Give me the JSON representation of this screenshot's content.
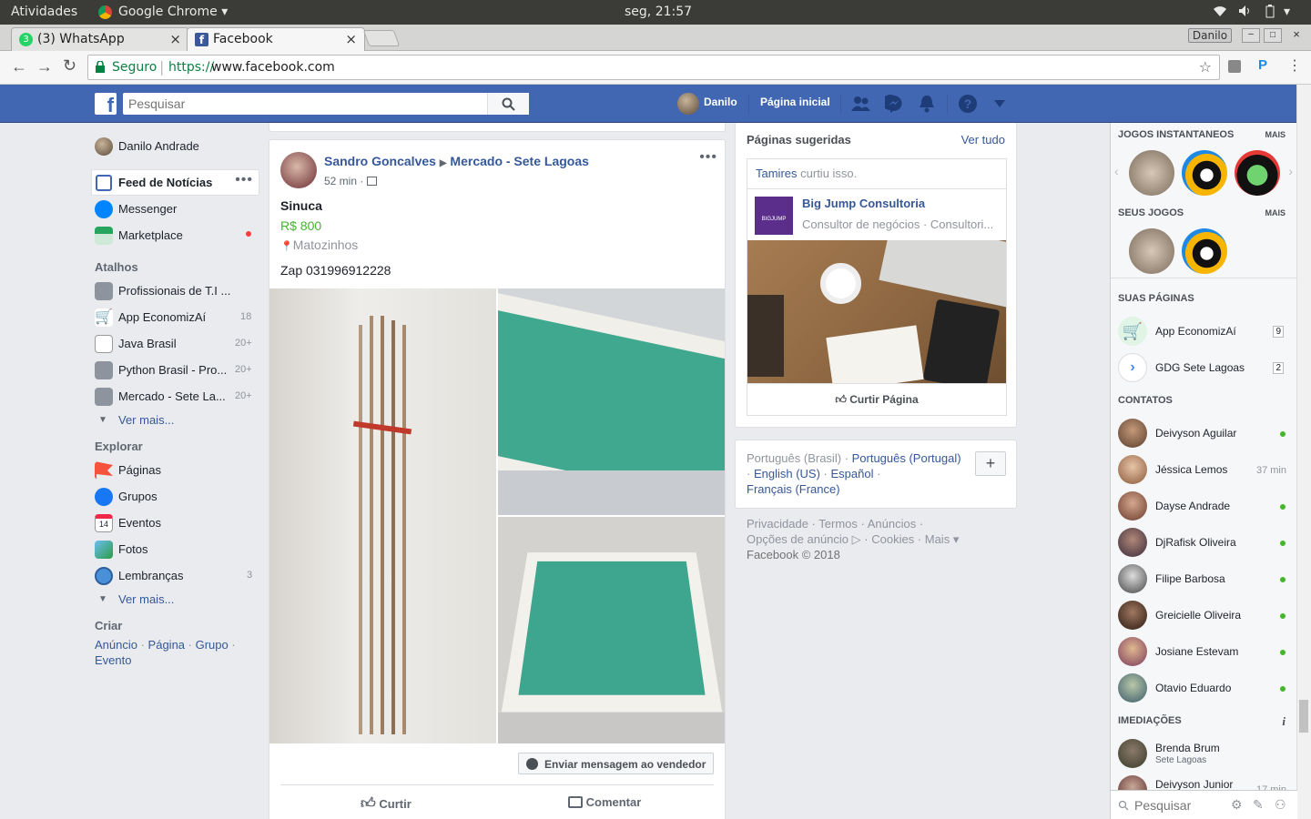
{
  "system_bar": {
    "activities": "Atividades",
    "app": "Google Chrome",
    "clock": "seg, 21:57"
  },
  "tabs": [
    {
      "label": "(3) WhatsApp",
      "close": "×"
    },
    {
      "label": "Facebook",
      "close": "×"
    }
  ],
  "window": {
    "user_label": "Danilo"
  },
  "address": {
    "secure_label": "Seguro",
    "url_prefix": "https://",
    "url_host": "www.facebook.com"
  },
  "fb_header": {
    "search_placeholder": "Pesquisar",
    "profile_name": "Danilo",
    "home": "Página inicial"
  },
  "left": {
    "profile": "Danilo Andrade",
    "main": [
      {
        "label": "Feed de Notícias"
      },
      {
        "label": "Messenger"
      },
      {
        "label": "Marketplace"
      }
    ],
    "shortcuts_title": "Atalhos",
    "shortcuts": [
      {
        "label": "Profissionais de T.I ...",
        "count": ""
      },
      {
        "label": "App EconomizAí",
        "count": "18"
      },
      {
        "label": "Java Brasil",
        "count": "20+"
      },
      {
        "label": "Python Brasil - Pro...",
        "count": "20+"
      },
      {
        "label": "Mercado - Sete La...",
        "count": "20+"
      }
    ],
    "see_more": "Ver mais...",
    "explore_title": "Explorar",
    "explore": [
      {
        "label": "Páginas",
        "count": ""
      },
      {
        "label": "Grupos",
        "count": ""
      },
      {
        "label": "Eventos",
        "count": ""
      },
      {
        "label": "Fotos",
        "count": ""
      },
      {
        "label": "Lembranças",
        "count": "3"
      }
    ],
    "see_more2": "Ver mais...",
    "create_title": "Criar",
    "create_links": [
      "Anúncio",
      "Página",
      "Grupo",
      "Evento"
    ]
  },
  "post": {
    "author": "Sandro Goncalves",
    "group": "Mercado - Sete Lagoas",
    "time": "52 min",
    "title": "Sinuca",
    "price": "R$ 800",
    "location": "Matozinhos",
    "body": "Zap 031996912228",
    "message_button": "Enviar mensagem ao vendedor",
    "like": "Curtir",
    "comment": "Comentar"
  },
  "suggested": {
    "title": "Páginas sugeridas",
    "see_all": "Ver tudo",
    "friend": "Tamires",
    "liked_text": "curtiu isso.",
    "page_name": "Big Jump Consultoria",
    "page_desc": "Consultor de negócios · Consultori...",
    "logo_text": "BIGJUMP",
    "like_page": "Curtir Página"
  },
  "languages": {
    "current": "Português (Brasil)",
    "options": [
      "Português (Portugal)",
      "English (US)",
      "Español",
      "Français (France)"
    ],
    "add": "+"
  },
  "footer": {
    "links": [
      "Privacidade",
      "Termos",
      "Anúncios",
      "Opções de anúncio",
      "Cookies",
      "Mais"
    ],
    "copyright": "Facebook © 2018"
  },
  "chat": {
    "instant_games": "JOGOS INSTANTANEOS",
    "mais": "MAIS",
    "my_games": "SEUS JOGOS",
    "my_pages": "SUAS PÁGINAS",
    "pages": [
      {
        "name": "App EconomizAí",
        "count": "9"
      },
      {
        "name": "GDG Sete Lagoas",
        "count": "2"
      }
    ],
    "contacts_title": "CONTATOS",
    "contacts": [
      {
        "name": "Deivyson Aguilar",
        "status": "online",
        "time": ""
      },
      {
        "name": "Jéssica Lemos",
        "status": "away",
        "time": "37 min"
      },
      {
        "name": "Dayse Andrade",
        "status": "online",
        "time": ""
      },
      {
        "name": "DjRafisk Oliveira",
        "status": "online",
        "time": ""
      },
      {
        "name": "Filipe Barbosa",
        "status": "online",
        "time": ""
      },
      {
        "name": "Greicielle Oliveira",
        "status": "online",
        "time": ""
      },
      {
        "name": "Josiane Estevam",
        "status": "online",
        "time": ""
      },
      {
        "name": "Otavio Eduardo",
        "status": "online",
        "time": ""
      }
    ],
    "nearby_title": "IMEDIAÇÕES",
    "nearby": [
      {
        "name": "Brenda Brum",
        "sub": "Sete Lagoas",
        "time": ""
      },
      {
        "name": "Deivyson Junior",
        "sub": "",
        "time": "17 min"
      }
    ],
    "search_placeholder": "Pesquisar"
  },
  "colors": {
    "fb_blue": "#4267b2",
    "link": "#365899",
    "price_green": "#42b72a",
    "online": "#42b72a"
  }
}
